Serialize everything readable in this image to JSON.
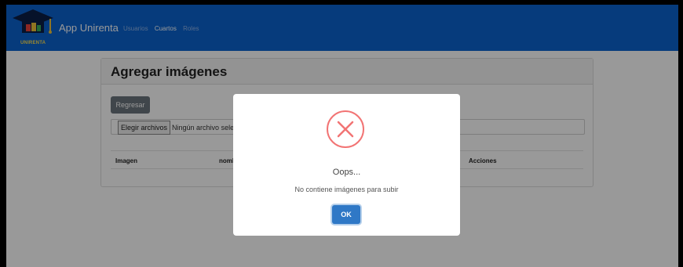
{
  "app": {
    "name": "App Unirenta",
    "logo_text": "UNIRENTA"
  },
  "nav": {
    "items": [
      {
        "label": "Usuarios",
        "active": false
      },
      {
        "label": "Cuartos",
        "active": true
      },
      {
        "label": "Roles",
        "active": false
      }
    ]
  },
  "card": {
    "title": "Agregar imágenes",
    "back_button": "Regresar",
    "file_input": {
      "button_label": "Elegir archivos",
      "status_text": "Ningún archivo selec"
    }
  },
  "table": {
    "columns": [
      "Imagen",
      "nomb",
      "Acciones"
    ]
  },
  "modal": {
    "title": "Oops...",
    "message": "No contiene imágenes para subir",
    "ok_label": "OK",
    "icon": "error-x-icon"
  },
  "colors": {
    "navbar": "#0b63cf",
    "error": "#f27474",
    "ok": "#2f78c6",
    "back_button": "#6c757d"
  }
}
